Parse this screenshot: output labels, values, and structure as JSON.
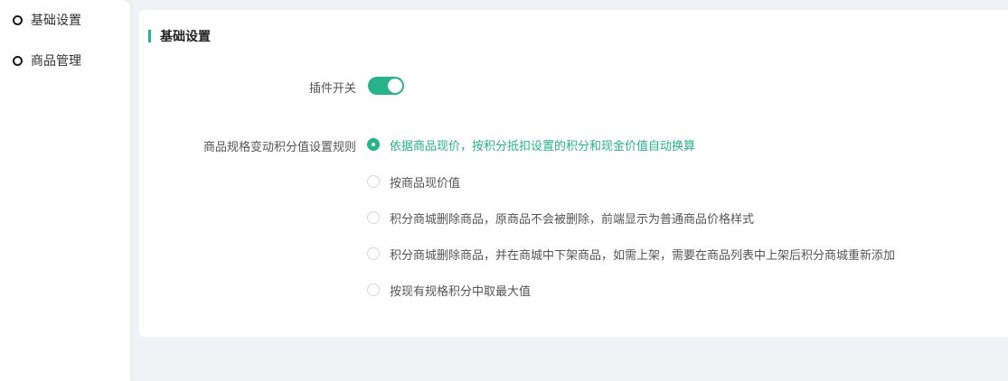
{
  "sidebar": {
    "items": [
      {
        "label": "基础设置"
      },
      {
        "label": "商品管理"
      }
    ]
  },
  "card": {
    "title": "基础设置",
    "plugin_switch": {
      "label": "插件开关",
      "state": "on"
    },
    "rule": {
      "label": "商品规格变动积分值设置规则",
      "options": [
        {
          "label": "依据商品现价，按积分抵扣设置的积分和现金价值自动换算",
          "checked": true
        },
        {
          "label": "按商品现价值",
          "checked": false
        },
        {
          "label": "积分商城删除商品，原商品不会被删除，前端显示为普通商品价格样式",
          "checked": false
        },
        {
          "label": "积分商城删除商品，并在商城中下架商品，如需上架，需要在商品列表中上架后积分商城重新添加",
          "checked": false
        },
        {
          "label": "按现有规格积分中取最大值",
          "checked": false
        }
      ]
    }
  },
  "colors": {
    "accent": "#26b38a",
    "background": "#f0f2f5"
  }
}
